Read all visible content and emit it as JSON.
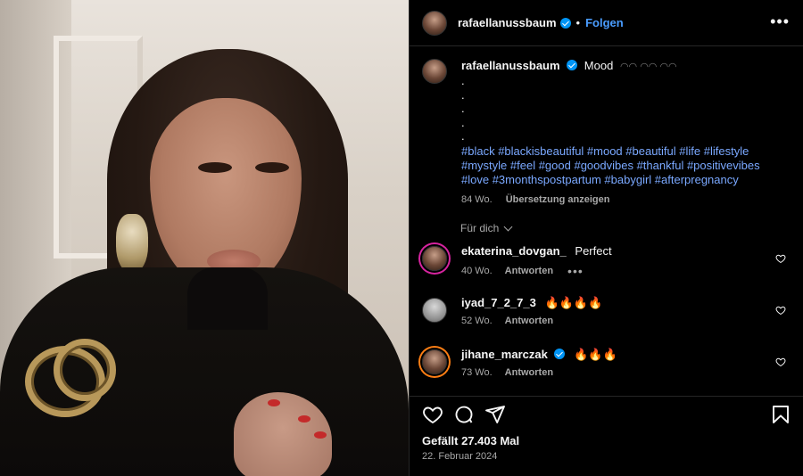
{
  "post": {
    "username": "rafaellanussbaum",
    "follow_label": "Folgen",
    "separator": "•",
    "more_glyph": "•••",
    "caption_text": "Mood",
    "caption_emojis": "◠◠ ◠◠ ◠◠",
    "caption_dots": [
      ".",
      ".",
      ".",
      ".",
      "."
    ],
    "hashtags_line1": "#black #blackisbeautiful #mood #beautiful #life #lifestyle",
    "hashtags_line2": "#mystyle #feel #good #goodvibes #thankful #positivevibes",
    "hashtags_line3": "#love #3monthspostpartum #babygirl #afterpregnancy",
    "age": "84 Wo.",
    "translate_label": "Übersetzung anzeigen"
  },
  "for_you_label": "Für dich",
  "comments": [
    {
      "username": "ekaterina_dovgan_",
      "text": "Perfect",
      "age": "40 Wo.",
      "reply": "Antworten",
      "more": "•••"
    },
    {
      "username": "iyad_7_2_7_3",
      "text": "🔥🔥🔥🔥",
      "age": "52 Wo.",
      "reply": "Antworten"
    },
    {
      "username": "jihane_marczak",
      "text": "🔥🔥🔥",
      "age": "73 Wo.",
      "reply": "Antworten"
    }
  ],
  "likes_label": "Gefällt 27.403 Mal",
  "date_label": "22. Februar 2024",
  "colors": {
    "accent_link": "#4a9dff",
    "verified": "#0095f6",
    "hashtag": "#7aa8ff",
    "background": "#000000"
  },
  "icons": [
    "verified-badge-icon",
    "more-options-icon",
    "chevron-down-icon",
    "heart-icon",
    "comment-icon",
    "share-icon",
    "bookmark-icon"
  ]
}
